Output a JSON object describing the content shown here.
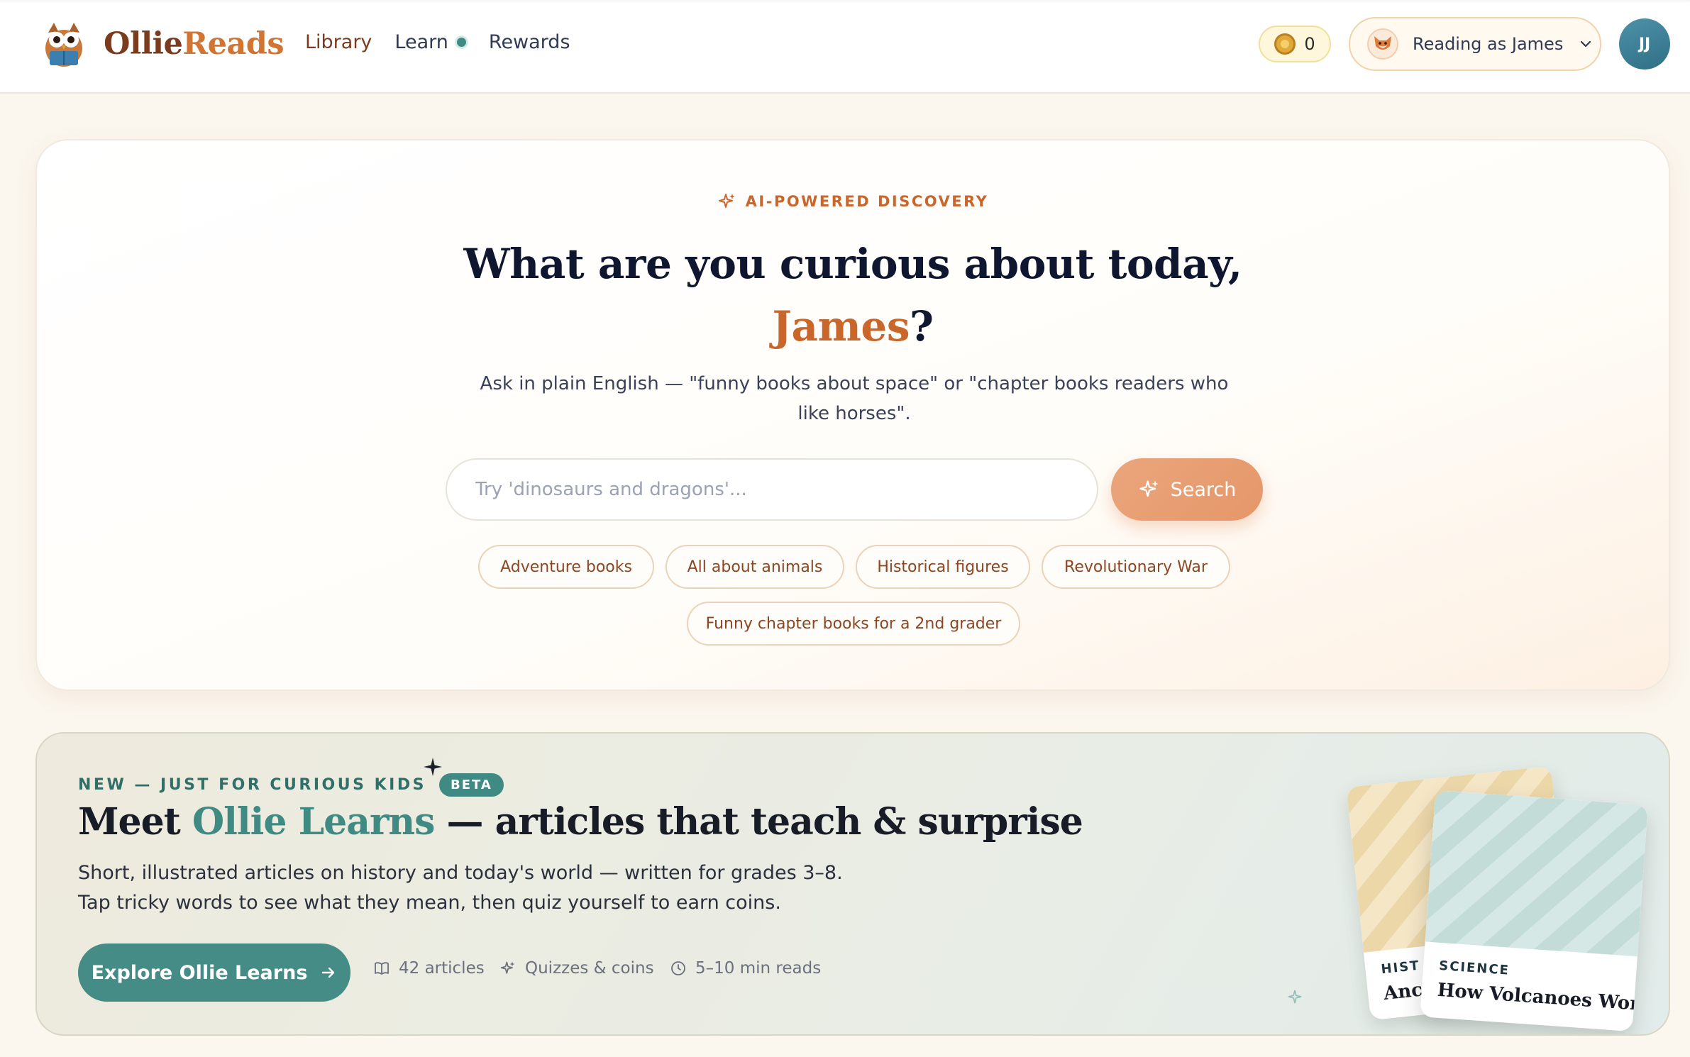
{
  "nav": {
    "brand_part1": "Ollie",
    "brand_part2": "Reads",
    "links": [
      "Library",
      "Learn",
      "Rewards"
    ],
    "coins": "0",
    "reader_label": "Reading as James",
    "avatar_initials": "JJ"
  },
  "hero": {
    "eyebrow": "AI-POWERED DISCOVERY",
    "title_prefix": "What are you curious about today,",
    "title_name": "James",
    "title_suffix": "?",
    "subtitle": "Ask in plain English — \"funny books about space\" or \"chapter books readers who like horses\".",
    "search_placeholder": "Try 'dinosaurs and dragons'...",
    "search_value": "",
    "search_button": "Search",
    "chips": [
      "Adventure books",
      "All about animals",
      "Historical figures",
      "Revolutionary War",
      "Funny chapter books for a 2nd grader"
    ]
  },
  "learn": {
    "eyebrow": "NEW — JUST FOR CURIOUS KIDS",
    "badge": "BETA",
    "title_prefix": "Meet ",
    "title_highlight": "Ollie Learns",
    "title_suffix": " — articles that teach & surprise",
    "description": "Short, illustrated articles on history and today's world — written for grades 3–8. Tap tricky words to see what they mean, then quiz yourself to earn coins.",
    "explore_button": "Explore Ollie Learns",
    "meta": [
      "42 articles",
      "Quizzes & coins",
      "5–10 min reads"
    ],
    "card_back_label": "HIST",
    "card_back_title": "Anc",
    "card_front_label": "SCIENCE",
    "card_front_title": "How Volcanoes Work"
  },
  "colors": {
    "brand_dark": "#7a3b1f",
    "brand_orange": "#d07534",
    "teal": "#3f8a83",
    "search_button": "#e59769"
  }
}
